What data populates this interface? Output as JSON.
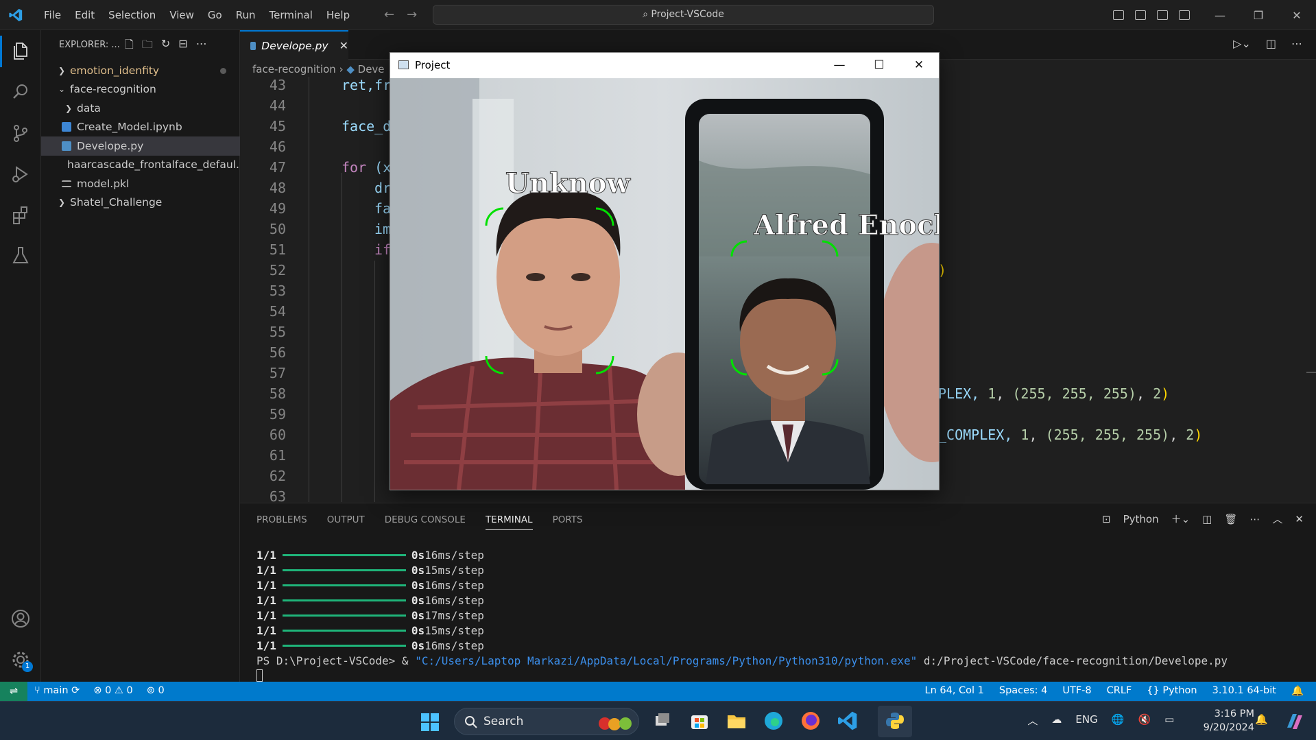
{
  "titlebar": {
    "menu": [
      "File",
      "Edit",
      "Selection",
      "View",
      "Go",
      "Run",
      "Terminal",
      "Help"
    ],
    "search": "Project-VSCode"
  },
  "sidebar": {
    "header": "EXPLORER: ...",
    "items": [
      {
        "label": "emotion_idenfity",
        "type": "folder"
      },
      {
        "label": "face-recognition",
        "type": "folder"
      },
      {
        "label": "data",
        "type": "folder"
      },
      {
        "label": "Create_Model.ipynb",
        "type": "notebook"
      },
      {
        "label": "Develope.py",
        "type": "python"
      },
      {
        "label": "haarcascade_frontalface_defaul...",
        "type": "xml"
      },
      {
        "label": "model.pkl",
        "type": "file"
      },
      {
        "label": "Shatel_Challenge",
        "type": "folder"
      }
    ]
  },
  "editor": {
    "tab": "Develope.py",
    "breadcrumb": [
      "face-recognition",
      "Deve"
    ],
    "line_numbers": [
      "43",
      "44",
      "45",
      "46",
      "47",
      "48",
      "49",
      "50",
      "51",
      "52",
      "53",
      "54",
      "55",
      "56",
      "57",
      "58",
      "59",
      "60",
      "61",
      "62",
      "63"
    ],
    "visible_code": {
      "l43": "ret,fr",
      "l45": "face_d",
      "l47_kw": "for",
      "l47_rest": " (x",
      "l48": "dr",
      "l49": "fa",
      "l50": "im",
      "l51": "if",
      "l52_tail": ")",
      "l58_a": "PLEX, ",
      "l58_b": "1",
      "l58_c": ", ",
      "l58_d": "(255, 255, 255)",
      "l58_e": ", ",
      "l58_f": "2",
      "l58_g": ")",
      "l60_a": "_COMPLEX, ",
      "l60_b": "1",
      "l60_c": ", ",
      "l60_d": "(255, 255, 255)",
      "l60_e": ", ",
      "l60_f": "2",
      "l60_g": ")"
    }
  },
  "panel": {
    "tabs": [
      "PROBLEMS",
      "OUTPUT",
      "DEBUG CONSOLE",
      "TERMINAL",
      "PORTS"
    ],
    "active_tab": "TERMINAL",
    "shell": "Python",
    "terminal_lines": [
      {
        "step": "1/1",
        "time": "0s",
        "rate": "16ms/step"
      },
      {
        "step": "1/1",
        "time": "0s",
        "rate": "15ms/step"
      },
      {
        "step": "1/1",
        "time": "0s",
        "rate": "16ms/step"
      },
      {
        "step": "1/1",
        "time": "0s",
        "rate": "16ms/step"
      },
      {
        "step": "1/1",
        "time": "0s",
        "rate": "17ms/step"
      },
      {
        "step": "1/1",
        "time": "0s",
        "rate": "15ms/step"
      },
      {
        "step": "1/1",
        "time": "0s",
        "rate": "16ms/step"
      }
    ],
    "prompt": "PS D:\\Project-VSCode> & ",
    "exe_path": "\"C:/Users/Laptop Markazi/AppData/Local/Programs/Python/Python310/python.exe\"",
    "script_path": " d:/Project-VSCode/face-recognition/Develope.py"
  },
  "statusbar": {
    "branch": "main",
    "errors": "0",
    "warnings": "0",
    "ports": "0",
    "position": "Ln 64, Col 1",
    "spaces": "Spaces: 4",
    "encoding": "UTF-8",
    "eol": "CRLF",
    "language": "Python",
    "interpreter": "3.10.1 64-bit"
  },
  "project_window": {
    "title": "Project",
    "labels": [
      "Unknow",
      "Alfred Enoch"
    ]
  },
  "taskbar": {
    "search": "Search",
    "lang": "ENG",
    "time": "3:16 PM",
    "date": "9/20/2024"
  },
  "colors": {
    "accent": "#0078d4",
    "statusbar": "#007acc",
    "terminal_bar": "#1fb57a",
    "face_box": "#00e000"
  }
}
